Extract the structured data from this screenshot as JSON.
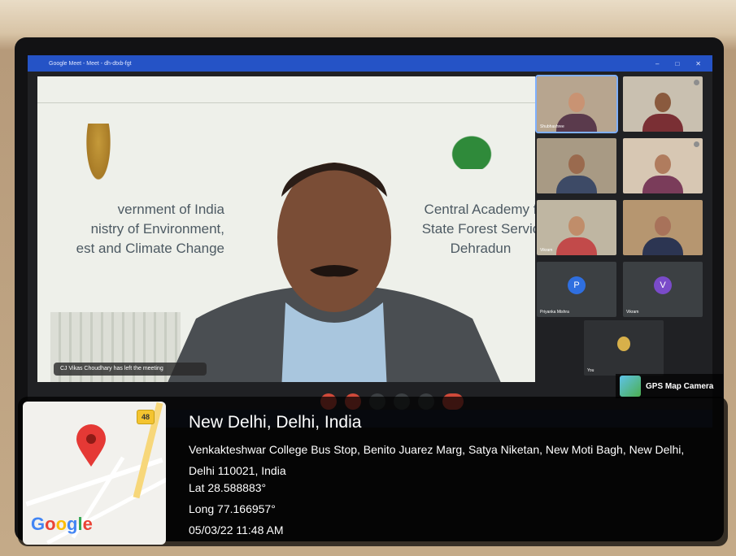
{
  "meeting": {
    "window_title": "Google Meet - Meet - dh-dtxb-fgt",
    "caption_text": "CJ Vikas Choudhary has left the meeting",
    "slide_left_lines": [
      "vernment of India",
      "nistry of Environment,",
      "est and Climate Change"
    ],
    "slide_right_lines": [
      "Central Academy f",
      "State Forest Servic",
      "Dehradun"
    ],
    "participants": [
      {
        "name": "Shubhashree",
        "type": "video"
      },
      {
        "name": "",
        "type": "video"
      },
      {
        "name": "",
        "type": "video"
      },
      {
        "name": "",
        "type": "video"
      },
      {
        "name": "Vikram",
        "type": "video"
      },
      {
        "name": "",
        "type": "video"
      },
      {
        "name": "Priyanka Mishra",
        "type": "avatar",
        "initial": "P",
        "color": "#2f6fe0"
      },
      {
        "name": "Vikram",
        "type": "avatar",
        "initial": "V",
        "color": "#7a4bc9"
      },
      {
        "name": "You",
        "type": "video"
      }
    ]
  },
  "gps_badge": {
    "label": "GPS Map Camera"
  },
  "location": {
    "title": "New Delhi, Delhi, India",
    "address": "Venkakteshwar College Bus Stop, Benito Juarez Marg, Satya Niketan, New Moti Bagh, New Delhi, Delhi 110021, India",
    "lat": "Lat 28.588883°",
    "long": "Long 77.166957°",
    "datetime": "05/03/22 11:48 AM"
  },
  "map": {
    "road_shield": "48",
    "logo": "Google"
  }
}
